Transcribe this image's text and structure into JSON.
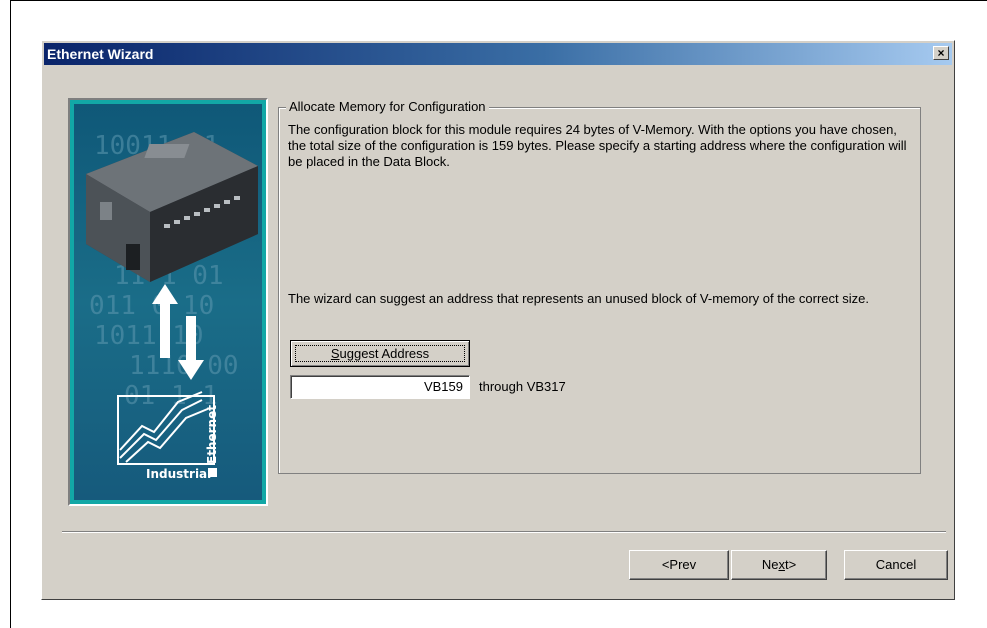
{
  "window": {
    "title": "Ethernet Wizard",
    "close_glyph": "×"
  },
  "banner": {
    "digits": [
      "10011 01",
      "11 1 01",
      "011 0 10",
      "1011 10",
      "1110 00",
      "01 1 1"
    ],
    "logo_word1": "Industrial",
    "logo_word2": "Ethernet"
  },
  "group": {
    "label": "Allocate Memory for Configuration",
    "paragraph1": "The configuration block for this module requires 24 bytes of V-Memory. With the options you have chosen, the total size of the configuration is 159 bytes. Please specify a starting address where the configuration will be placed in the Data Block.",
    "paragraph2": "The wizard can suggest an address that represents an unused block of V-memory of the correct size.",
    "suggest_button": {
      "mnemonic": "S",
      "rest": "uggest Address"
    },
    "address_value": "VB159",
    "through_text": "through VB317"
  },
  "footer": {
    "prev_label": "<Prev",
    "next": {
      "before": "Ne",
      "mnemonic": "x",
      "after": "t>"
    },
    "cancel_label": "Cancel"
  },
  "colors": {
    "titlebar_start": "#0a246a",
    "titlebar_end": "#a6caf0",
    "dialog_face": "#d4d0c8",
    "banner_teal": "#12a7a6",
    "banner_navy": "#0f5878"
  }
}
